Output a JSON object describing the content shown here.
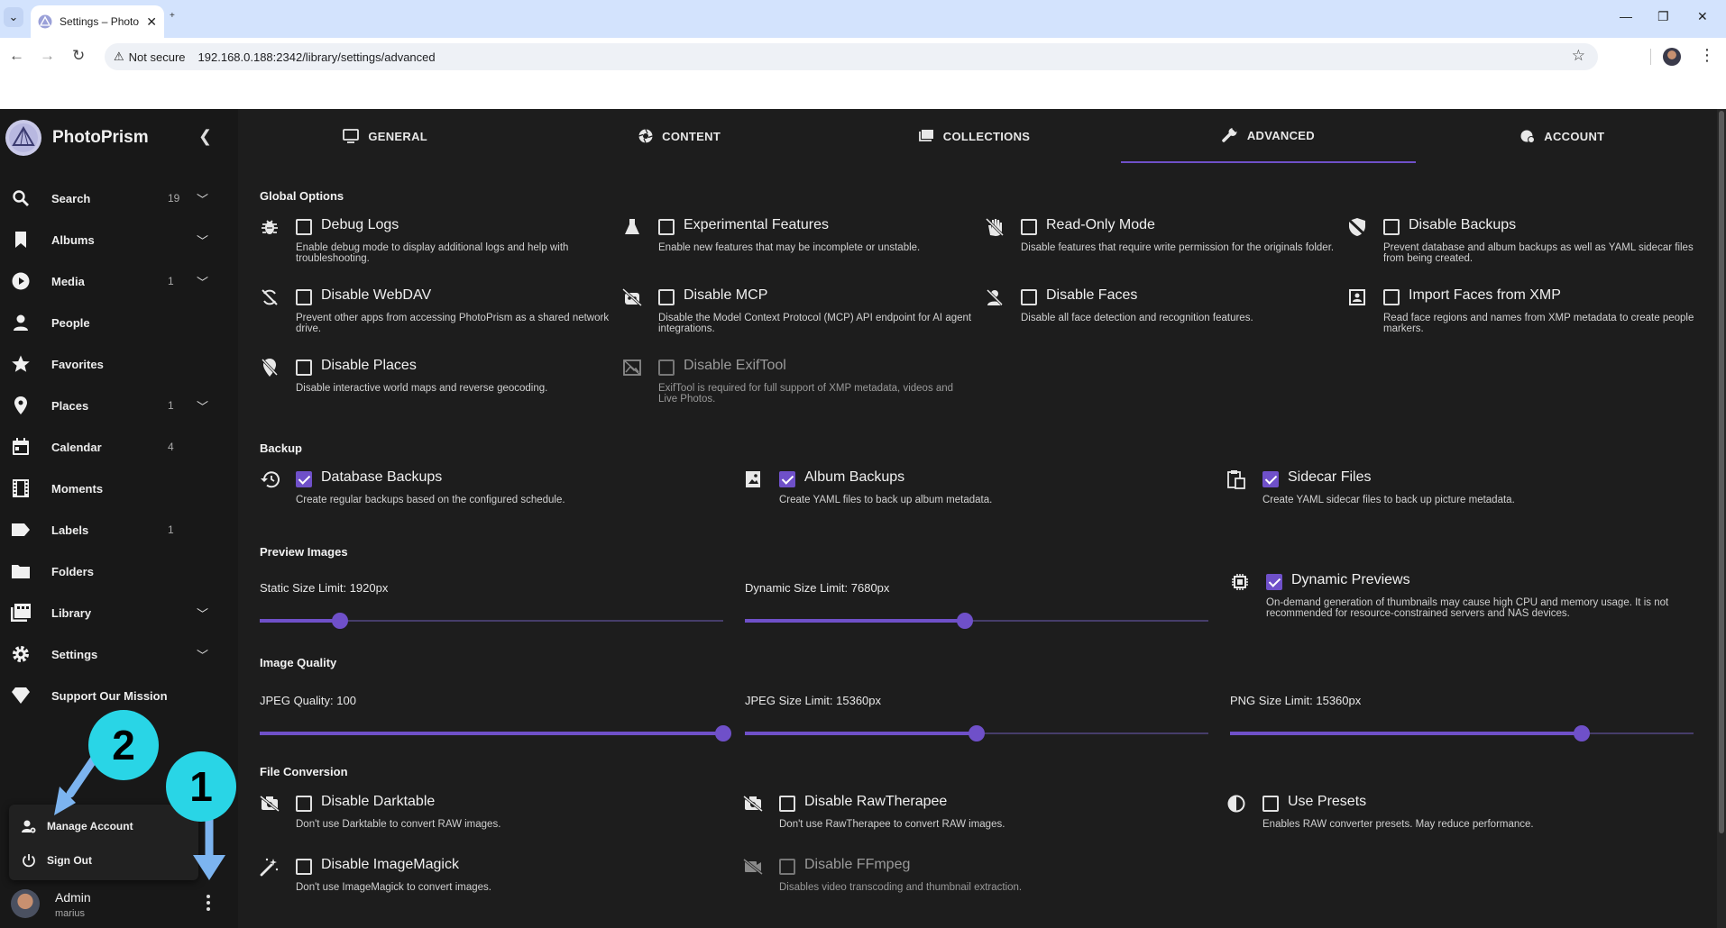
{
  "browser": {
    "tab_title": "Settings – PhotoPrism",
    "not_secure": "Not secure",
    "url": "192.168.0.188:2342/library/settings/advanced"
  },
  "sidebar": {
    "brand": "PhotoPrism",
    "items": [
      {
        "label": "Search",
        "count": "19",
        "chevron": true,
        "icon": "search-icon"
      },
      {
        "label": "Albums",
        "count": "",
        "chevron": true,
        "icon": "bookmark-icon"
      },
      {
        "label": "Media",
        "count": "1",
        "chevron": true,
        "icon": "play-circle-icon"
      },
      {
        "label": "People",
        "count": "",
        "chevron": false,
        "icon": "person-icon"
      },
      {
        "label": "Favorites",
        "count": "",
        "chevron": false,
        "icon": "star-icon"
      },
      {
        "label": "Places",
        "count": "1",
        "chevron": true,
        "icon": "map-pin-icon"
      },
      {
        "label": "Calendar",
        "count": "4",
        "chevron": false,
        "icon": "calendar-icon"
      },
      {
        "label": "Moments",
        "count": "",
        "chevron": false,
        "icon": "film-icon"
      },
      {
        "label": "Labels",
        "count": "1",
        "chevron": false,
        "icon": "label-icon"
      },
      {
        "label": "Folders",
        "count": "",
        "chevron": false,
        "icon": "folder-icon"
      },
      {
        "label": "Library",
        "count": "",
        "chevron": true,
        "icon": "library-icon"
      },
      {
        "label": "Settings",
        "count": "",
        "chevron": true,
        "icon": "gear-icon"
      },
      {
        "label": "Support Our Mission",
        "count": "",
        "chevron": false,
        "icon": "diamond-icon"
      }
    ],
    "menu": {
      "manage_account": "Manage Account",
      "sign_out": "Sign Out"
    },
    "user": {
      "name": "Admin",
      "handle": "marius"
    }
  },
  "annotations": {
    "step1": "1",
    "step2": "2"
  },
  "tabs": [
    {
      "label": "GENERAL",
      "icon": "monitor-icon",
      "active": false
    },
    {
      "label": "CONTENT",
      "icon": "aperture-icon",
      "active": false
    },
    {
      "label": "COLLECTIONS",
      "icon": "collections-icon",
      "active": false
    },
    {
      "label": "ADVANCED",
      "icon": "wrench-icon",
      "active": true
    },
    {
      "label": "ACCOUNT",
      "icon": "account-shield-icon",
      "active": false
    }
  ],
  "sections": {
    "global": "Global Options",
    "backup": "Backup",
    "preview": "Preview Images",
    "quality": "Image Quality",
    "conversion": "File Conversion"
  },
  "global_options": [
    {
      "title": "Debug Logs",
      "desc": "Enable debug mode to display additional logs and help with troubleshooting.",
      "checked": false,
      "disabled": false,
      "icon": "bug-icon"
    },
    {
      "title": "Experimental Features",
      "desc": "Enable new features that may be incomplete or unstable.",
      "checked": false,
      "disabled": false,
      "icon": "flask-icon"
    },
    {
      "title": "Read-Only Mode",
      "desc": "Disable features that require write permission for the originals folder.",
      "checked": false,
      "disabled": false,
      "icon": "hand-off-icon"
    },
    {
      "title": "Disable Backups",
      "desc": "Prevent database and album backups as well as YAML sidecar files from being created.",
      "checked": false,
      "disabled": false,
      "icon": "shield-off-icon"
    },
    {
      "title": "Disable WebDAV",
      "desc": "Prevent other apps from accessing PhotoPrism as a shared network drive.",
      "checked": false,
      "disabled": false,
      "icon": "sync-off-icon"
    },
    {
      "title": "Disable MCP",
      "desc": "Disable the Model Context Protocol (MCP) API endpoint for AI agent integrations.",
      "checked": false,
      "disabled": false,
      "icon": "robot-off-icon"
    },
    {
      "title": "Disable Faces",
      "desc": "Disable all face detection and recognition features.",
      "checked": false,
      "disabled": false,
      "icon": "face-off-icon"
    },
    {
      "title": "Import Faces from XMP",
      "desc": "Read face regions and names from XMP metadata to create people markers.",
      "checked": false,
      "disabled": false,
      "icon": "portrait-icon"
    },
    {
      "title": "Disable Places",
      "desc": "Disable interactive world maps and reverse geocoding.",
      "checked": false,
      "disabled": false,
      "icon": "map-off-icon"
    },
    {
      "title": "Disable ExifTool",
      "desc": "ExifTool is required for full support of XMP metadata, videos and Live Photos.",
      "checked": false,
      "disabled": true,
      "icon": "image-off-icon"
    }
  ],
  "backup_options": [
    {
      "title": "Database Backups",
      "desc": "Create regular backups based on the configured schedule.",
      "checked": true,
      "disabled": false,
      "icon": "history-icon"
    },
    {
      "title": "Album Backups",
      "desc": "Create YAML files to back up album metadata.",
      "checked": true,
      "disabled": false,
      "icon": "album-icon"
    },
    {
      "title": "Sidecar Files",
      "desc": "Create YAML sidecar files to back up picture metadata.",
      "checked": true,
      "disabled": false,
      "icon": "clipboard-file-icon"
    }
  ],
  "preview": {
    "static_label": "Static Size Limit: 1920px",
    "static_value": 1920,
    "static_min": 720,
    "static_max": 7680,
    "dynamic_label": "Dynamic Size Limit: 7680px",
    "dynamic_value": 7680,
    "dynamic_min": 720,
    "dynamic_max": 15360,
    "dynamic_previews": {
      "title": "Dynamic Previews",
      "desc": "On-demand generation of thumbnails may cause high CPU and memory usage. It is not recommended for resource-constrained servers and NAS devices.",
      "checked": true,
      "icon": "chip-icon"
    }
  },
  "quality": {
    "jpeg_label": "JPEG Quality: 100",
    "jpeg_value": 100,
    "jpeg_min": 25,
    "jpeg_max": 100,
    "jpeg_size_label": "JPEG Size Limit: 15360px",
    "jpeg_size_value": 15360,
    "jpeg_size_min": 720,
    "jpeg_size_max": 30000,
    "png_label": "PNG Size Limit: 15360px",
    "png_value": 15360,
    "png_min": 720,
    "png_max": 20000
  },
  "conversion_options": [
    {
      "title": "Disable Darktable",
      "desc": "Don't use Darktable to convert RAW images.",
      "checked": false,
      "disabled": false,
      "icon": "camera-off-icon"
    },
    {
      "title": "Disable RawTherapee",
      "desc": "Don't use RawTherapee to convert RAW images.",
      "checked": false,
      "disabled": false,
      "icon": "camera-off-icon"
    },
    {
      "title": "Use Presets",
      "desc": "Enables RAW converter presets. May reduce performance.",
      "checked": false,
      "disabled": false,
      "icon": "contrast-icon"
    },
    {
      "title": "Disable ImageMagick",
      "desc": "Don't use ImageMagick to convert images.",
      "checked": false,
      "disabled": false,
      "icon": "magic-wand-icon"
    },
    {
      "title": "Disable FFmpeg",
      "desc": "Disables video transcoding and thumbnail extraction.",
      "checked": false,
      "disabled": true,
      "icon": "video-off-icon"
    }
  ],
  "colors": {
    "accent": "#6f50c9",
    "badge": "#29d5e6",
    "arrow": "#7cb4f0"
  }
}
